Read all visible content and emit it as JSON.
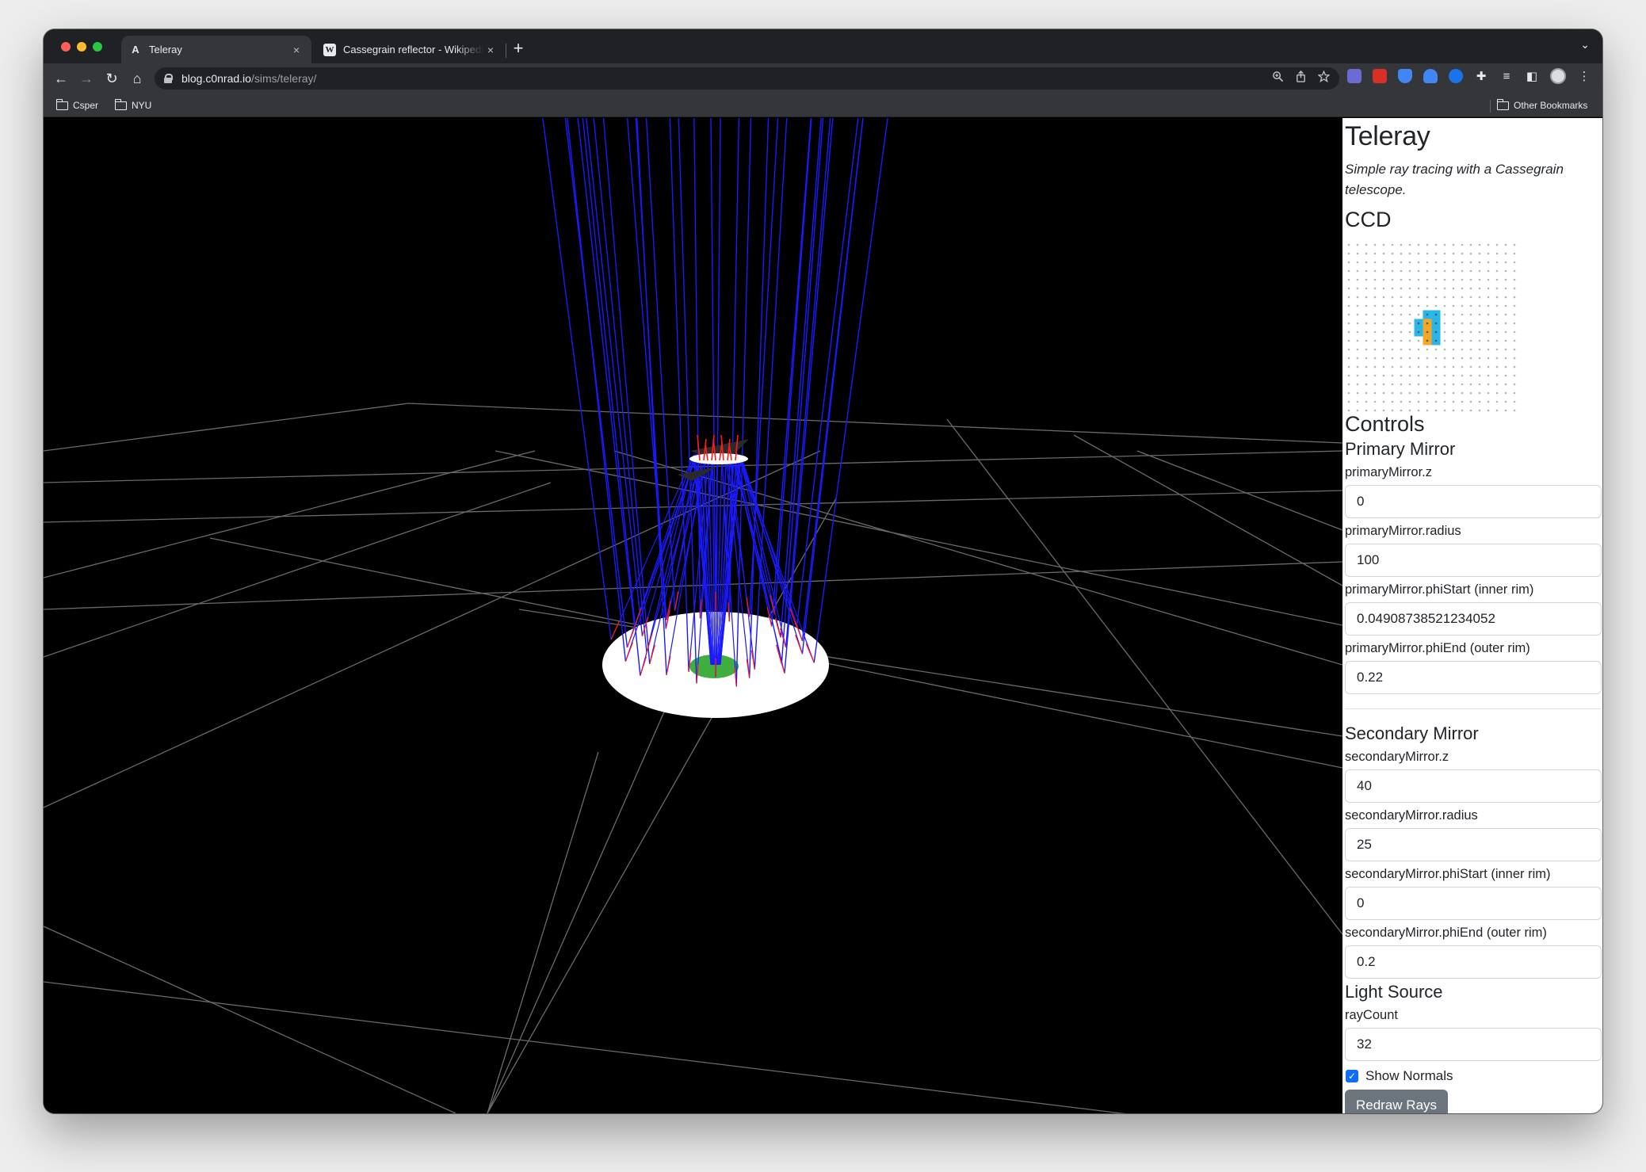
{
  "browser": {
    "tabs": [
      {
        "favicon": "A",
        "title": "Teleray",
        "close": "×"
      },
      {
        "favicon": "W",
        "title": "Cassegrain reflector - Wikipedia",
        "close": "×"
      }
    ],
    "new_tab": "+",
    "tab_menu": "⌄",
    "nav": {
      "back": "←",
      "forward": "→",
      "reload": "↻",
      "home": "⌂"
    },
    "url": {
      "host": "blog.c0nrad.io",
      "path": "/sims/teleray/"
    },
    "omnibox_icons": [
      "zoom-icon",
      "share-icon",
      "star-icon"
    ],
    "extension_colors": [
      "#6b6bd6",
      "#d93025",
      "#4285f4",
      "#4285f4",
      "#1a73e8"
    ],
    "bookmarks": [
      {
        "label": "Csper"
      },
      {
        "label": "NYU"
      }
    ],
    "other_bookmarks": "Other Bookmarks"
  },
  "page": {
    "title": "Teleray",
    "subtitle": "Simple ray tracing with a Cassegrain telescope.",
    "ccd_heading": "CCD",
    "ccd": {
      "cols": 20,
      "rows": 20,
      "hit_color_cyan": "#29b6e8",
      "hit_color_orange": "#f5a623",
      "dot_color": "#b5b5b5"
    },
    "controls_heading": "Controls",
    "primary": {
      "heading": "Primary Mirror",
      "z_label": "primaryMirror.z",
      "z_value": "0",
      "radius_label": "primaryMirror.radius",
      "radius_value": "100",
      "phiStart_label": "primaryMirror.phiStart (inner rim)",
      "phiStart_value": "0.04908738521234052",
      "phiEnd_label": "primaryMirror.phiEnd (outer rim)",
      "phiEnd_value": "0.22"
    },
    "secondary": {
      "heading": "Secondary Mirror",
      "z_label": "secondaryMirror.z",
      "z_value": "40",
      "radius_label": "secondaryMirror.radius",
      "radius_value": "25",
      "phiStart_label": "secondaryMirror.phiStart (inner rim)",
      "phiStart_value": "0",
      "phiEnd_label": "secondaryMirror.phiEnd (outer rim)",
      "phiEnd_value": "0.2"
    },
    "light": {
      "heading": "Light Source",
      "rayCount_label": "rayCount",
      "rayCount_value": "32",
      "show_normals_label": "Show Normals",
      "show_normals_checked": true,
      "redraw_label": "Redraw Rays"
    }
  },
  "colors": {
    "ray": "#1a1aff",
    "normal": "#ff1a1a",
    "grid": "#6a6a6a",
    "mirror": "#ffffff",
    "ccd_plate": "#3fae3f",
    "button": "#6c757d",
    "checkbox": "#0d6efd"
  }
}
